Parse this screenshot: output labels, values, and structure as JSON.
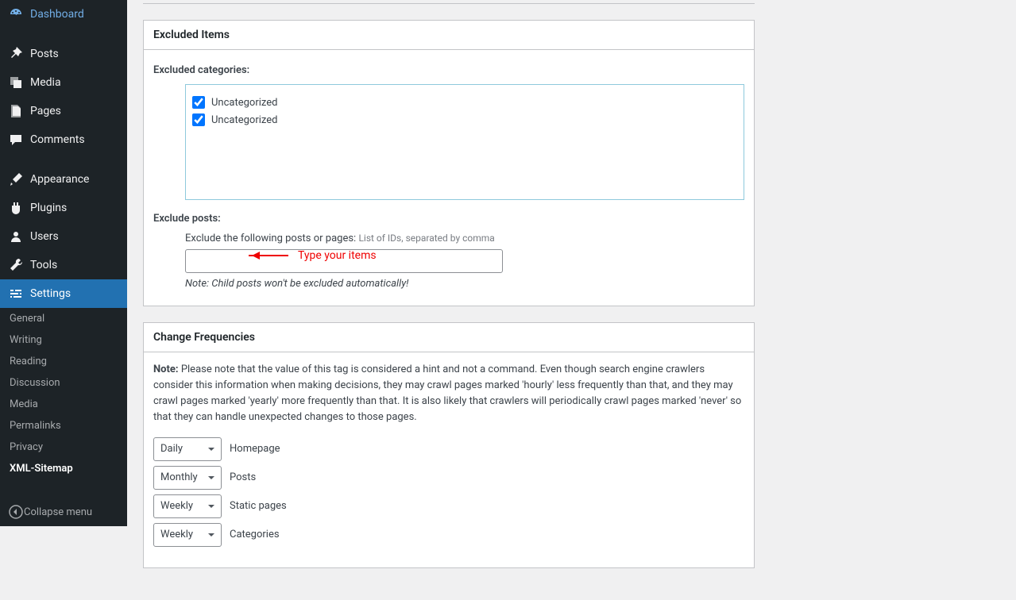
{
  "sidebar": {
    "items": [
      {
        "label": "Dashboard",
        "icon": "dashboard"
      },
      {
        "label": "Posts",
        "icon": "pin"
      },
      {
        "label": "Media",
        "icon": "media"
      },
      {
        "label": "Pages",
        "icon": "pages"
      },
      {
        "label": "Comments",
        "icon": "comment"
      },
      {
        "label": "Appearance",
        "icon": "brush"
      },
      {
        "label": "Plugins",
        "icon": "plug"
      },
      {
        "label": "Users",
        "icon": "user"
      },
      {
        "label": "Tools",
        "icon": "wrench"
      },
      {
        "label": "Settings",
        "icon": "sliders"
      }
    ],
    "submenu": [
      {
        "label": "General"
      },
      {
        "label": "Writing"
      },
      {
        "label": "Reading"
      },
      {
        "label": "Discussion"
      },
      {
        "label": "Media"
      },
      {
        "label": "Permalinks"
      },
      {
        "label": "Privacy"
      },
      {
        "label": "XML-Sitemap"
      }
    ],
    "collapse": "Collapse menu"
  },
  "excluded": {
    "title": "Excluded Items",
    "categories_label": "Excluded categories:",
    "categories": [
      {
        "label": "Uncategorized",
        "checked": true
      },
      {
        "label": "Uncategorized",
        "checked": true
      }
    ],
    "posts_label": "Exclude posts:",
    "posts_hint_prefix": "Exclude the following posts or pages: ",
    "posts_hint_suffix": "List of IDs, separated by comma",
    "input_value": "",
    "note": "Note: Child posts won't be excluded automatically!",
    "annotation": "Type your items"
  },
  "freq": {
    "title": "Change Frequencies",
    "note_label": "Note:",
    "note_text": " Please note that the value of this tag is considered a hint and not a command. Even though search engine crawlers consider this information when making decisions, they may crawl pages marked 'hourly' less frequently than that, and they may crawl pages marked 'yearly' more frequently than that. It is also likely that crawlers will periodically crawl pages marked 'never' so that they can handle unexpected changes to those pages.",
    "rows": [
      {
        "value": "Daily",
        "label": "Homepage"
      },
      {
        "value": "Monthly",
        "label": "Posts"
      },
      {
        "value": "Weekly",
        "label": "Static pages"
      },
      {
        "value": "Weekly",
        "label": "Categories"
      }
    ]
  }
}
